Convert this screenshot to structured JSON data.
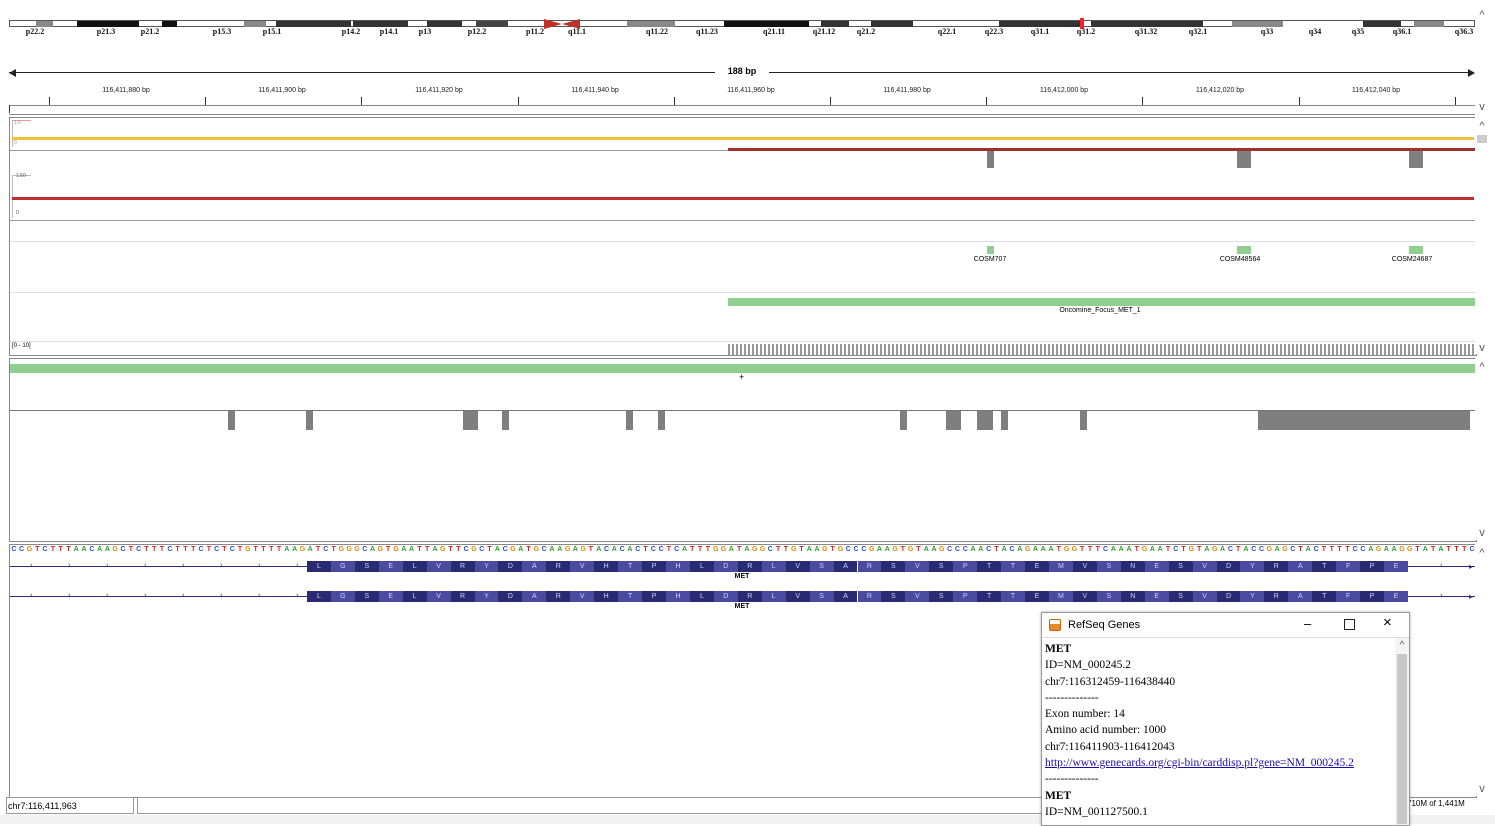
{
  "ideogram": {
    "bands": [
      "p22.2",
      "p21.3",
      "p21.2",
      "p15.3",
      "p15.1",
      "p14.2",
      "p14.1",
      "p13",
      "p12.2",
      "p11.2",
      "q11.1",
      "q11.22",
      "q11.23",
      "q21.11",
      "q21.12",
      "q21.2",
      "q22.1",
      "q22.3",
      "q31.1",
      "q31.2",
      "q31.32",
      "q32.1",
      "q33",
      "q34",
      "q35",
      "q36.1",
      "q36.3"
    ]
  },
  "ruler": {
    "span_label": "188 bp",
    "ticks": [
      "116,411,880 bp",
      "116,411,900 bp",
      "116,411,920 bp",
      "116,411,940 bp",
      "116,411,960 bp",
      "116,411,980 bp",
      "116,412,000 bp",
      "116,412,020 bp",
      "116,412,040 bp"
    ]
  },
  "tracks": {
    "coverage_scale_top": "1.5",
    "coverage_scale_bottom": "0",
    "signal_scale_top": "1.50",
    "signal_scale_bottom": "0",
    "cosmic": [
      "COSM707",
      "COSM48564",
      "COSM24687"
    ],
    "panel_region": "Oncomine_Focus_MET_1",
    "readcount_range": "[0 - 10]",
    "gene_label_1": "MET",
    "gene_label_2": "MET"
  },
  "sequence": {
    "bases": "CCGTCTTTAACAAGCTCTTTCTTTCTCTCTGTTTTAAGATCTGGGCAGTGAATTAGTTCGCTACGATGCAAGAGTACACACTCCTCATTTGGATAGGCTTGTAAGTGCCCGAAGTGTAAGCCCAACTACAGAAATGGTTTCAAATGAATCTGTAGACTACCGAGCTACTTTTCCAGAAGGTATATTTC",
    "amino_acids": [
      "L",
      "G",
      "S",
      "E",
      "L",
      "V",
      "R",
      "Y",
      "D",
      "A",
      "R",
      "V",
      "H",
      "T",
      "P",
      "H",
      "L",
      "D",
      "R",
      "L",
      "V",
      "S",
      "A",
      "R",
      "S",
      "V",
      "S",
      "P",
      "T",
      "T",
      "E",
      "M",
      "V",
      "S",
      "N",
      "E",
      "S",
      "V",
      "D",
      "Y",
      "R",
      "A",
      "T",
      "F",
      "P",
      "E"
    ]
  },
  "popup": {
    "title": "RefSeq Genes",
    "lines": [
      {
        "text": "MET",
        "bold": true
      },
      {
        "text": "ID=NM_000245.2"
      },
      {
        "text": "chr7:116312459-116438440"
      },
      {
        "text": "--------------"
      },
      {
        "text": "Exon number: 14"
      },
      {
        "text": "Amino acid number: 1000"
      },
      {
        "text": "chr7:116411903-116412043"
      },
      {
        "text": "http://www.genecards.org/cgi-bin/carddisp.pl?gene=NM_000245.2",
        "link": true
      },
      {
        "text": "--------------"
      },
      {
        "text": "MET",
        "bold": true
      },
      {
        "text": "ID=NM_001127500.1"
      }
    ]
  },
  "status": {
    "locus": "chr7:116,411,963",
    "memory": "710M of 1,441M"
  },
  "icons": {
    "minimize": "minimize-icon",
    "maximize": "maximize-icon",
    "close": "close-icon",
    "java": "java-cup-icon"
  },
  "colors": {
    "coverage_line": "#f0c040",
    "signal_line": "#c0302b",
    "cosmic_feature": "#8fcf8f",
    "panel_region": "#8fcf8f",
    "amino_dark": "#2a2a72",
    "amino_light": "#4a4aa0",
    "link": "#1a0dab",
    "centromere": "#c0302b",
    "highlight": "#ff2020"
  }
}
